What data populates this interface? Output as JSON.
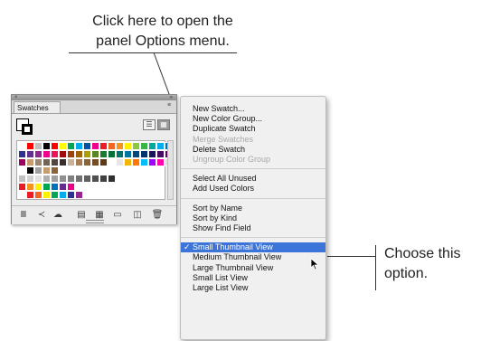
{
  "callouts": {
    "top_line1": "Click here to open the",
    "top_line2": "panel Options menu.",
    "right_line1": "Choose this",
    "right_line2": "option."
  },
  "panel": {
    "tab_label": "Swatches",
    "close_glyph": "×",
    "collapse_glyph": "»",
    "menu_button_glyph": "≡",
    "view_list_icon": "list-view-icon",
    "view_thumb_icon": "thumbnail-view-icon",
    "footer_icons": [
      {
        "name": "swatch-libraries-icon",
        "glyph": "Ⅲ"
      },
      {
        "name": "kind-menu-icon",
        "glyph": "≺"
      },
      {
        "name": "cc-libraries-icon",
        "glyph": "☁"
      },
      {
        "name": "swatch-options-icon",
        "glyph": "▤"
      },
      {
        "name": "color-group-options-icon",
        "glyph": "▦"
      },
      {
        "name": "new-color-group-icon",
        "glyph": "▭"
      },
      {
        "name": "new-swatch-icon",
        "glyph": "◫"
      },
      {
        "name": "delete-swatch-icon",
        "glyph": "🗑"
      }
    ],
    "swatch_rows": [
      [
        "#ffffff",
        "#ff0000",
        "#c0c0c0",
        "#000000",
        "#ff0000",
        "#ffff00",
        "#00a651",
        "#00aeef",
        "#0054a6",
        "#ec008c",
        "#ed1c24",
        "#f26522",
        "#f7941d",
        "#fff200",
        "#8dc63f",
        "#39b54a",
        "#00a99d",
        "#00aeef",
        "#0072bc"
      ],
      [
        "#2e3192",
        "#662d91",
        "#92278f",
        "#ec008c",
        "#ed145b",
        "#9e0b0f",
        "#a0410d",
        "#a3620a",
        "#aba000",
        "#598527",
        "#1a7b30",
        "#007236",
        "#00746b",
        "#0076a3",
        "#004a80",
        "#003471",
        "#1b1464",
        "#440e62",
        "#630460"
      ],
      [
        "#9e005d",
        "#c69c6d",
        "#998675",
        "#736357",
        "#534741",
        "#362f2d",
        "#c7b299",
        "#a67c52",
        "#8c6239",
        "#754c24",
        "#603913",
        "#ffffff",
        "#e6e6e6",
        "#f4b400",
        "#ff7700",
        "#00bfff",
        "#a000ff",
        "#ff00aa",
        "#e0e0e0"
      ],
      [
        "#ffffff",
        "#000000",
        "#a0a0a0",
        "#c69c6d",
        "#8c6239"
      ],
      [
        "#c0c0c0",
        "#d0d0d0",
        "#e0e0e0",
        "#b0b0b0",
        "#a0a0a0",
        "#909090",
        "#808080",
        "#707070",
        "#606060",
        "#505050",
        "#404040",
        "#303030"
      ],
      [
        "#ed1c24",
        "#f7941d",
        "#fff200",
        "#00a651",
        "#0072bc",
        "#662d91",
        "#ec008c",
        "#ffffff"
      ],
      [
        "#ffffff",
        "#ed1c24",
        "#f26522",
        "#fff200",
        "#00a651",
        "#00aeef",
        "#2e3192",
        "#92278f"
      ]
    ]
  },
  "menu": {
    "items": [
      {
        "label": "New Swatch...",
        "disabled": false
      },
      {
        "label": "New Color Group...",
        "disabled": false
      },
      {
        "label": "Duplicate Swatch",
        "disabled": false
      },
      {
        "label": "Merge Swatches",
        "disabled": true
      },
      {
        "label": "Delete Swatch",
        "disabled": false
      },
      {
        "label": "Ungroup Color Group",
        "disabled": true
      },
      {
        "sep": true
      },
      {
        "label": "Select All Unused",
        "disabled": false
      },
      {
        "label": "Add Used Colors",
        "disabled": false
      },
      {
        "sep": true
      },
      {
        "label": "Sort by Name",
        "disabled": false
      },
      {
        "label": "Sort by Kind",
        "disabled": false
      },
      {
        "label": "Show Find Field",
        "disabled": false
      },
      {
        "sep": true
      },
      {
        "label": "Small Thumbnail View",
        "disabled": false,
        "selected": true,
        "checked": true
      },
      {
        "label": "Medium Thumbnail View",
        "disabled": false
      },
      {
        "label": "Large Thumbnail View",
        "disabled": false
      },
      {
        "label": "Small List View",
        "disabled": false
      },
      {
        "label": "Large List View",
        "disabled": false
      }
    ],
    "check_glyph": "✓",
    "highlight_color": "#3d74d9"
  }
}
